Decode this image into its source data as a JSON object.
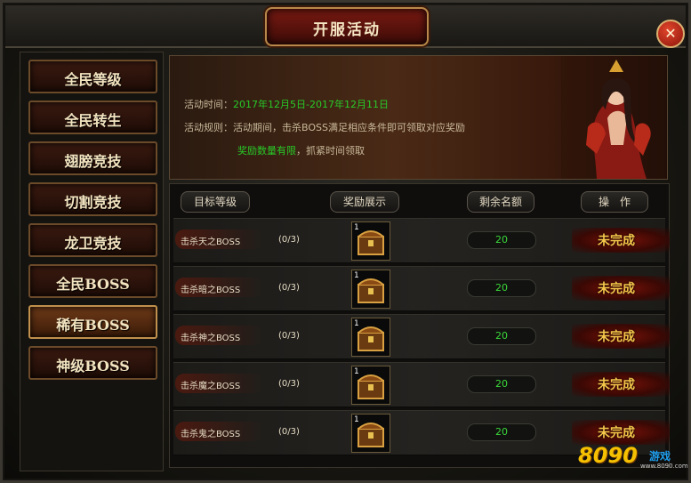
{
  "window": {
    "title": "开服活动",
    "close_symbol": "✕"
  },
  "sidebar": {
    "items": [
      {
        "label": "全民等级"
      },
      {
        "label": "全民转生"
      },
      {
        "label": "翅膀竞技"
      },
      {
        "label": "切割竞技"
      },
      {
        "label": "龙卫竞技"
      },
      {
        "label": "全民BOSS"
      },
      {
        "label": "稀有BOSS",
        "active": true
      },
      {
        "label": "神级BOSS"
      }
    ]
  },
  "banner": {
    "time_label": "活动时间：",
    "time_value": "2017年12月5日-2017年12月11日",
    "rule_label": "活动规则：",
    "rule_text": "活动期间，击杀BOSS满足相应条件即可领取对应奖励",
    "limit_highlight": "奖励数量有限",
    "limit_text": "，抓紧时间领取"
  },
  "table": {
    "headers": {
      "target": "目标等级",
      "reward": "奖励展示",
      "remaining": "剩余名额",
      "action": "操　作"
    },
    "rows": [
      {
        "boss": "击杀天之BOSS",
        "progress": "(0/3)",
        "reward_count": "1",
        "remaining": "20",
        "status": "未完成"
      },
      {
        "boss": "击杀暗之BOSS",
        "progress": "(0/3)",
        "reward_count": "1",
        "remaining": "20",
        "status": "未完成"
      },
      {
        "boss": "击杀神之BOSS",
        "progress": "(0/3)",
        "reward_count": "1",
        "remaining": "20",
        "status": "未完成"
      },
      {
        "boss": "击杀魔之BOSS",
        "progress": "(0/3)",
        "reward_count": "1",
        "remaining": "20",
        "status": "未完成"
      },
      {
        "boss": "击杀鬼之BOSS",
        "progress": "(0/3)",
        "reward_count": "1",
        "remaining": "20",
        "status": "未完成"
      }
    ]
  },
  "watermark": {
    "number": "8090",
    "name": "游戏",
    "sub": "www.8090.com"
  },
  "colors": {
    "accent_gold": "#f4c64a",
    "highlight_green": "#28c928",
    "title_red": "#7a1a12"
  }
}
